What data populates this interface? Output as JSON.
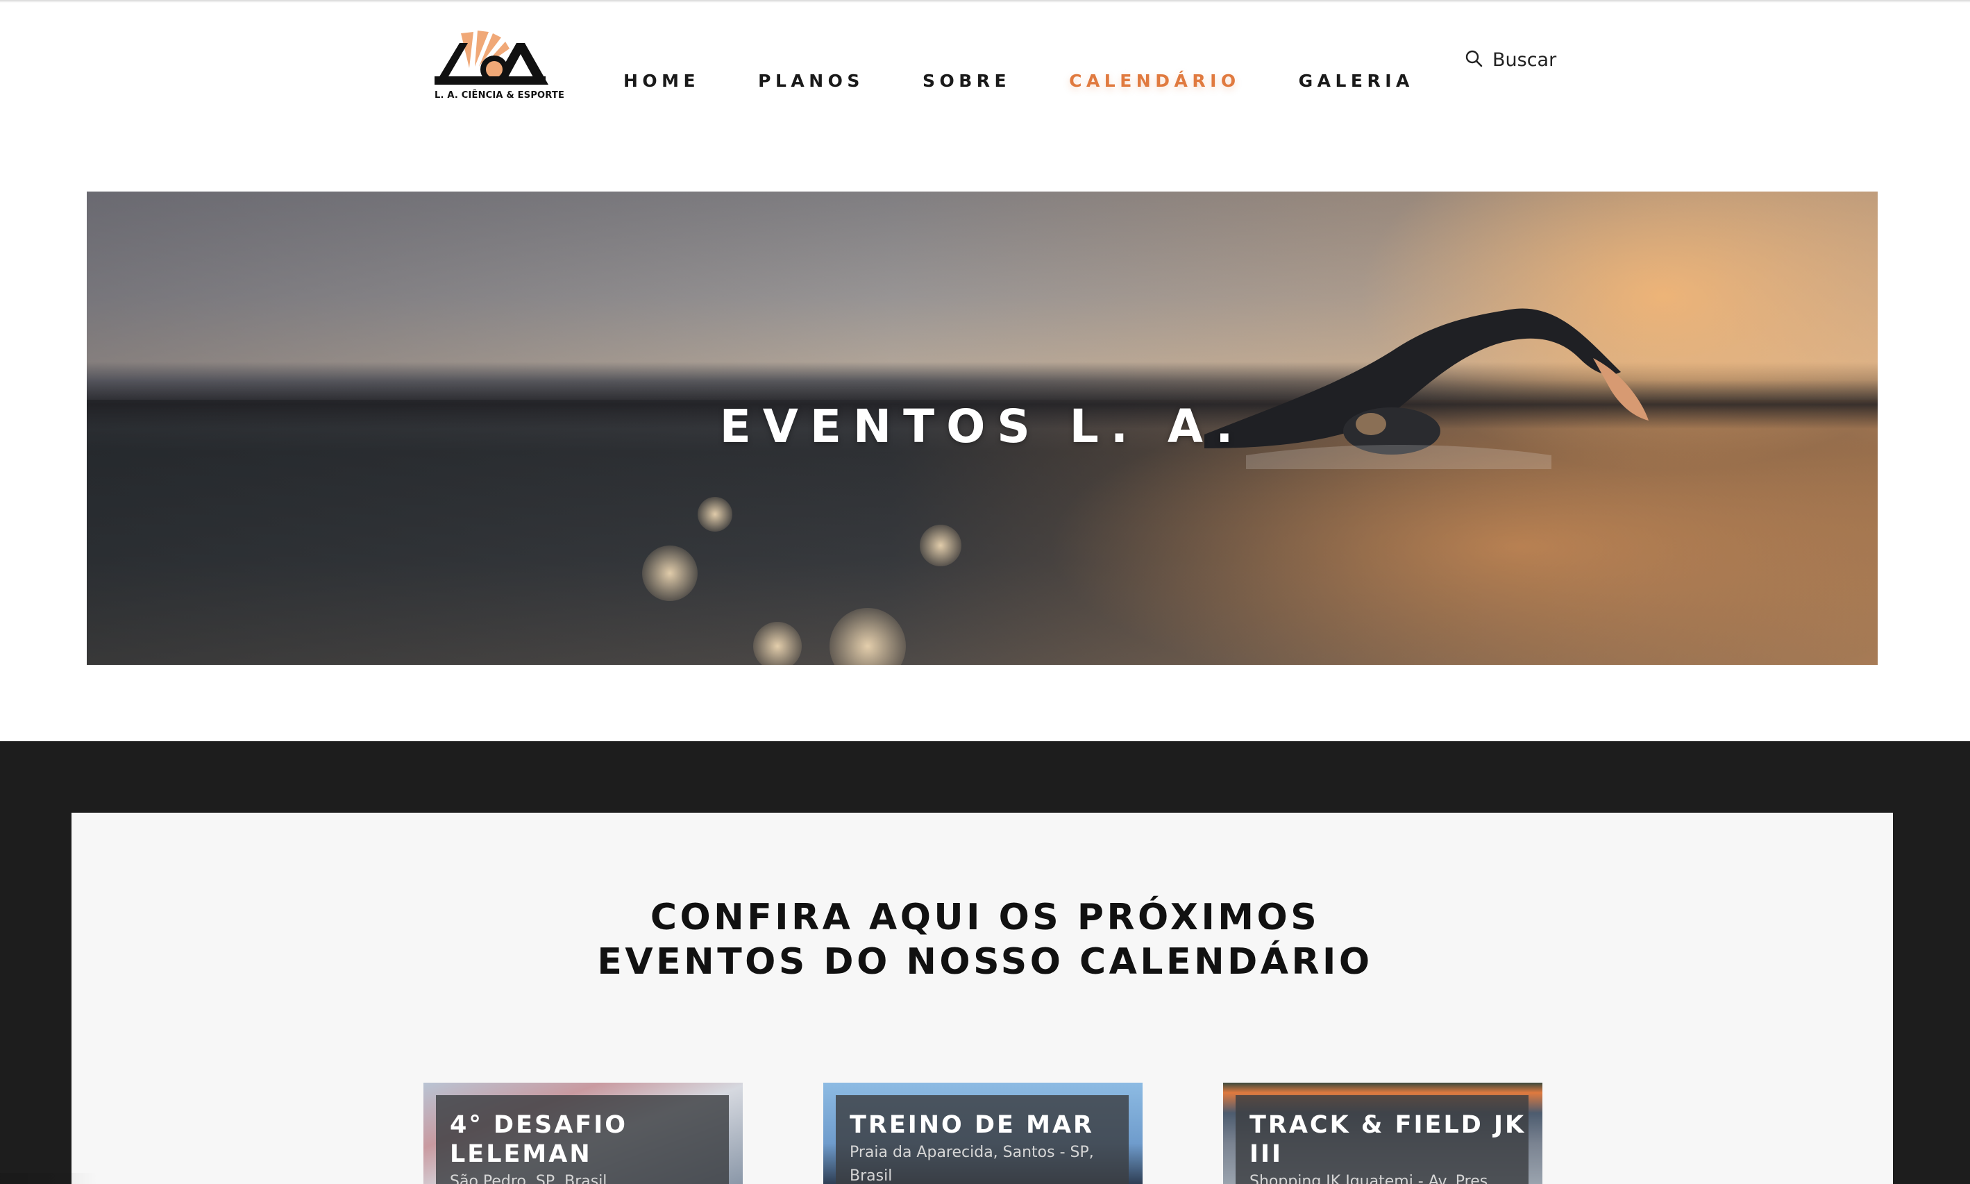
{
  "brand": {
    "logo_text": "L. A. CIÊNCIA & ESPORTE",
    "accent": "#e07a3f"
  },
  "nav": {
    "items": [
      {
        "label": "HOME"
      },
      {
        "label": "PLANOS"
      },
      {
        "label": "SOBRE"
      },
      {
        "label": "CALENDÁRIO",
        "active": true
      },
      {
        "label": "GALERIA"
      }
    ]
  },
  "search": {
    "label": "Buscar",
    "icon": "search-icon"
  },
  "hero": {
    "title": "EVENTOS L. A."
  },
  "events_section": {
    "title_line1": "CONFIRA AQUI OS PRÓXIMOS",
    "title_line2": "EVENTOS DO NOSSO CALENDÁRIO",
    "cards": [
      {
        "title": "4° DESAFIO LELEMAN",
        "location": "São Pedro, SP, Brasil"
      },
      {
        "title": "TREINO DE MAR",
        "location": "Praia da Aparecida, Santos - SP, Brasil"
      },
      {
        "title": "TRACK & FIELD JK III",
        "location": "Shopping JK Iguatemi - Av. Pres..."
      }
    ]
  }
}
